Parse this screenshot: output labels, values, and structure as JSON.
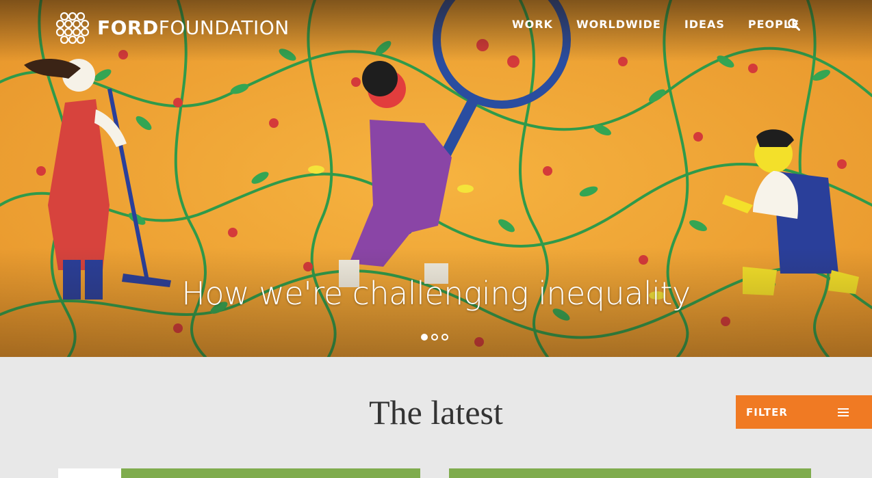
{
  "brand": {
    "name_bold": "FORD",
    "name_light": "FOUNDATION"
  },
  "nav": {
    "items": [
      {
        "label": "WORK"
      },
      {
        "label": "WORLDWIDE"
      },
      {
        "label": "IDEAS"
      },
      {
        "label": "PEOPLE"
      }
    ],
    "search_icon": "search-icon"
  },
  "hero": {
    "headline": "How we're challenging inequality",
    "slide_count": 3,
    "active_slide": 1
  },
  "latest": {
    "heading": "The latest",
    "filter_label": "FILTER",
    "filter_icon": "hamburger-menu-icon"
  },
  "colors": {
    "accent": "#f07a23",
    "card_green": "#7fac4d",
    "hero_orange": "#f0a733"
  }
}
